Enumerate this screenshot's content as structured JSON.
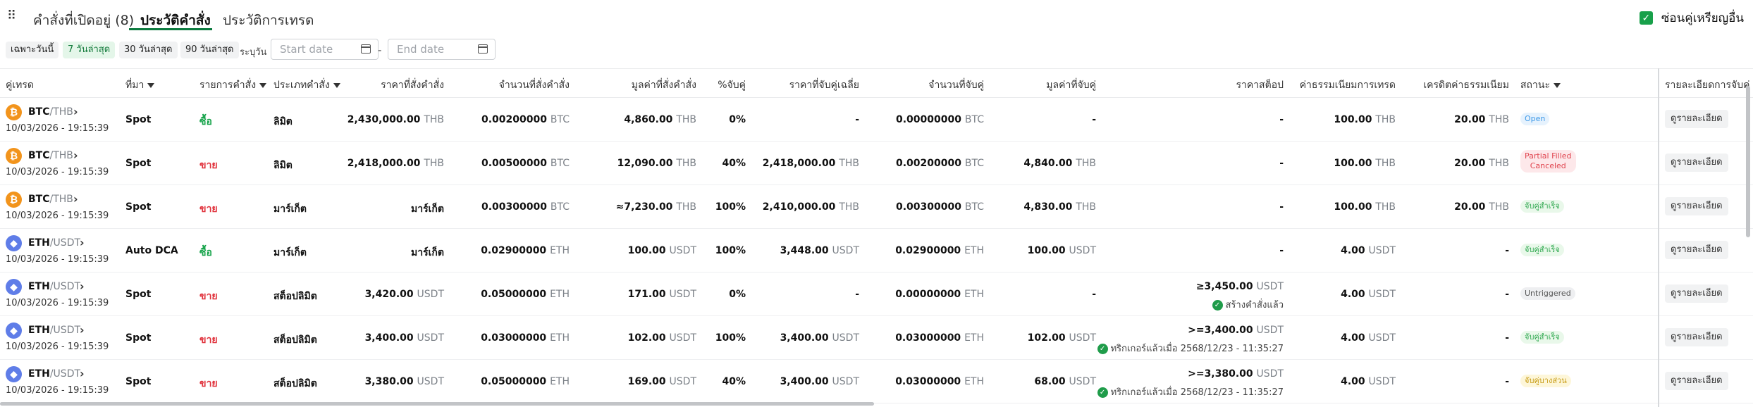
{
  "tabs": [
    {
      "label": "คำสั่งที่เปิดอยู่ (8)"
    },
    {
      "label": "ประวัติคำสั่ง"
    },
    {
      "label": "ประวัติการเทรด"
    }
  ],
  "hide_other_pairs": {
    "label": "ซ่อนคู่เหรียญอื่น",
    "checked": true
  },
  "filters": {
    "chips": [
      "เฉพาะวันนี้",
      "7 วันล่าสุด",
      "30 วันล่าสุด",
      "90 วันล่าสุด"
    ],
    "active_chip": "7 วันล่าสุด",
    "custom_label": "ระบุวัน",
    "start_placeholder": "Start date",
    "end_placeholder": "End date",
    "dash": "-"
  },
  "columns": [
    "คู่เทรด",
    "ที่มา",
    "รายการคำสั่ง",
    "ประเภทคำสั่ง",
    "ราคาที่สั่งคำสั่ง",
    "จำนวนที่สั่งคำสั่ง",
    "มูลค่าที่สั่งคำสั่ง",
    "%จับคู่",
    "ราคาที่จับคู่เฉลี่ย",
    "จำนวนที่จับคู่",
    "มูลค่าที่จับคู่",
    "ราคาสต็อป",
    "ค่าธรรมเนียมการเทรด",
    "เครดิตค่าธรรมเนียม",
    "สถานะ",
    "รายละเอียดการจับคู่"
  ],
  "detail_button_label": "ดูรายละเอียด",
  "rows": [
    {
      "base": "BTC",
      "quote": "/THB",
      "time": "10/03/2026 - 19:15:39",
      "source": "Spot",
      "side": "ซื้อ",
      "side_type": "buy",
      "order_type": "ลิมิต",
      "price": "2,430,000.00",
      "price_unit": "THB",
      "qty": "0.00200000",
      "qty_unit": "BTC",
      "value": "4,860.00",
      "value_unit": "THB",
      "pct": "0%",
      "avg_price": "-",
      "avg_unit": "",
      "filled_qty": "0.00000000",
      "filled_unit": "BTC",
      "filled_value": "-",
      "filled_value_unit": "",
      "stop": "-",
      "stop_unit": "",
      "stop_note": "",
      "fee": "100.00",
      "fee_unit": "THB",
      "credit": "20.00",
      "credit_unit": "THB",
      "status": "Open",
      "status2": "",
      "status_type": "open"
    },
    {
      "base": "BTC",
      "quote": "/THB",
      "time": "10/03/2026 - 19:15:39",
      "source": "Spot",
      "side": "ขาย",
      "side_type": "sell",
      "order_type": "ลิมิต",
      "price": "2,418,000.00",
      "price_unit": "THB",
      "qty": "0.00500000",
      "qty_unit": "BTC",
      "value": "12,090.00",
      "value_unit": "THB",
      "pct": "40%",
      "avg_price": "2,418,000.00",
      "avg_unit": "THB",
      "filled_qty": "0.00200000",
      "filled_unit": "BTC",
      "filled_value": "4,840.00",
      "filled_value_unit": "THB",
      "stop": "-",
      "stop_unit": "",
      "stop_note": "",
      "fee": "100.00",
      "fee_unit": "THB",
      "credit": "20.00",
      "credit_unit": "THB",
      "status": "Partial Filled",
      "status2": "Canceled",
      "status_type": "partial"
    },
    {
      "base": "BTC",
      "quote": "/THB",
      "time": "10/03/2026 - 19:15:39",
      "source": "Spot",
      "side": "ขาย",
      "side_type": "sell",
      "order_type": "มาร์เก็ต",
      "price": "มาร์เก็ต",
      "price_unit": "",
      "qty": "0.00300000",
      "qty_unit": "BTC",
      "value": "≈7,230.00",
      "value_unit": "THB",
      "pct": "100%",
      "avg_price": "2,410,000.00",
      "avg_unit": "THB",
      "filled_qty": "0.00300000",
      "filled_unit": "BTC",
      "filled_value": "4,830.00",
      "filled_value_unit": "THB",
      "stop": "-",
      "stop_unit": "",
      "stop_note": "",
      "fee": "100.00",
      "fee_unit": "THB",
      "credit": "20.00",
      "credit_unit": "THB",
      "status": "จับคู่สำเร็จ",
      "status2": "",
      "status_type": "match"
    },
    {
      "base": "ETH",
      "quote": "/USDT",
      "time": "10/03/2026 - 19:15:39",
      "source": "Auto DCA",
      "side": "ซื้อ",
      "side_type": "buy",
      "order_type": "มาร์เก็ต",
      "price": "มาร์เก็ต",
      "price_unit": "",
      "qty": "0.02900000",
      "qty_unit": "ETH",
      "value": "100.00",
      "value_unit": "USDT",
      "pct": "100%",
      "avg_price": "3,448.00",
      "avg_unit": "USDT",
      "filled_qty": "0.02900000",
      "filled_unit": "ETH",
      "filled_value": "100.00",
      "filled_value_unit": "USDT",
      "stop": "-",
      "stop_unit": "",
      "stop_note": "",
      "fee": "4.00",
      "fee_unit": "USDT",
      "credit": "-",
      "credit_unit": "",
      "status": "จับคู่สำเร็จ",
      "status2": "",
      "status_type": "match"
    },
    {
      "base": "ETH",
      "quote": "/USDT",
      "time": "10/03/2026 - 19:15:39",
      "source": "Spot",
      "side": "ขาย",
      "side_type": "sell",
      "order_type": "สต็อปลิมิต",
      "price": "3,420.00",
      "price_unit": "USDT",
      "qty": "0.05000000",
      "qty_unit": "ETH",
      "value": "171.00",
      "value_unit": "USDT",
      "pct": "0%",
      "avg_price": "-",
      "avg_unit": "",
      "filled_qty": "0.00000000",
      "filled_unit": "ETH",
      "filled_value": "-",
      "filled_value_unit": "",
      "stop": "≥3,450.00",
      "stop_unit": "USDT",
      "stop_note": "สร้างคำสั่งแล้ว",
      "fee": "4.00",
      "fee_unit": "USDT",
      "credit": "-",
      "credit_unit": "",
      "status": "Untriggered",
      "status2": "",
      "status_type": "untrig"
    },
    {
      "base": "ETH",
      "quote": "/USDT",
      "time": "10/03/2026 - 19:15:39",
      "source": "Spot",
      "side": "ขาย",
      "side_type": "sell",
      "order_type": "สต็อปลิมิต",
      "price": "3,400.00",
      "price_unit": "USDT",
      "qty": "0.03000000",
      "qty_unit": "ETH",
      "value": "102.00",
      "value_unit": "USDT",
      "pct": "100%",
      "avg_price": "3,400.00",
      "avg_unit": "USDT",
      "filled_qty": "0.03000000",
      "filled_unit": "ETH",
      "filled_value": "102.00",
      "filled_value_unit": "USDT",
      "stop": ">=3,400.00",
      "stop_unit": "USDT",
      "stop_note": "ทริกเกอร์แล้วเมื่อ 2568/12/23 - 11:35:27",
      "fee": "4.00",
      "fee_unit": "USDT",
      "credit": "-",
      "credit_unit": "",
      "status": "จับคู่สำเร็จ",
      "status2": "",
      "status_type": "match"
    },
    {
      "base": "ETH",
      "quote": "/USDT",
      "time": "10/03/2026 - 19:15:39",
      "source": "Spot",
      "side": "ขาย",
      "side_type": "sell",
      "order_type": "สต็อปลิมิต",
      "price": "3,380.00",
      "price_unit": "USDT",
      "qty": "0.05000000",
      "qty_unit": "ETH",
      "value": "169.00",
      "value_unit": "USDT",
      "pct": "40%",
      "avg_price": "3,400.00",
      "avg_unit": "USDT",
      "filled_qty": "0.03000000",
      "filled_unit": "ETH",
      "filled_value": "68.00",
      "filled_value_unit": "USDT",
      "stop": ">=3,380.00",
      "stop_unit": "USDT",
      "stop_note": "ทริกเกอร์แล้วเมื่อ 2568/12/23 - 11:35:27",
      "fee": "4.00",
      "fee_unit": "USDT",
      "credit": "-",
      "credit_unit": "",
      "status": "จับคู่บางส่วน",
      "status2": "",
      "status_type": "partmatch"
    }
  ]
}
